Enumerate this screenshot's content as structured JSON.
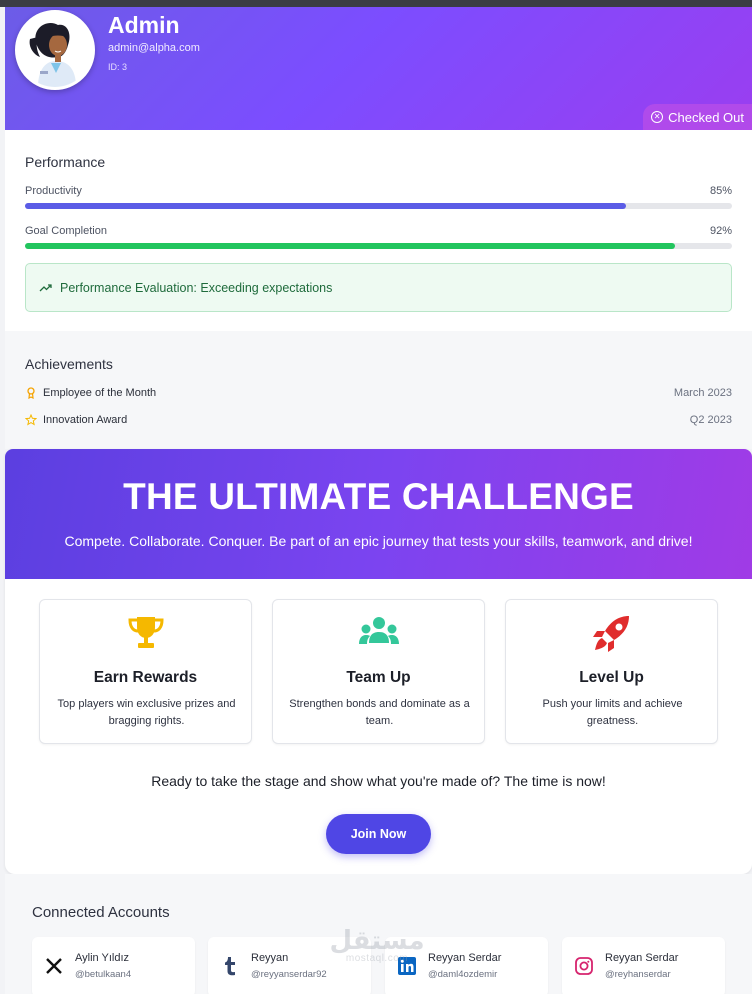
{
  "profile": {
    "name": "Admin",
    "email": "admin@alpha.com",
    "id_text": "ID: 3",
    "status": "Checked Out"
  },
  "performance": {
    "title": "Performance",
    "metrics": [
      {
        "label": "Productivity",
        "value_text": "85%",
        "value": 0.85,
        "color": "#5b5ce6"
      },
      {
        "label": "Goal Completion",
        "value_text": "92%",
        "value": 0.92,
        "color": "#22c55e"
      }
    ],
    "evaluation": "Performance Evaluation: Exceeding expectations"
  },
  "achievements": {
    "title": "Achievements",
    "items": [
      {
        "label": "Employee of the Month",
        "date": "March 2023",
        "icon": "medal-icon"
      },
      {
        "label": "Innovation Award",
        "date": "Q2 2023",
        "icon": "star-icon"
      }
    ]
  },
  "challenge": {
    "title": "THE ULTIMATE CHALLENGE",
    "subtitle": "Compete. Collaborate. Conquer. Be part of an epic journey that tests your skills, teamwork, and drive!",
    "features": [
      {
        "title": "Earn Rewards",
        "desc": "Top players win exclusive prizes and bragging rights.",
        "icon": "trophy-icon",
        "color": "#f5b800"
      },
      {
        "title": "Team Up",
        "desc": "Strengthen bonds and dominate as a team.",
        "icon": "users-icon",
        "color": "#34c79a"
      },
      {
        "title": "Level Up",
        "desc": "Push your limits and achieve greatness.",
        "icon": "rocket-icon",
        "color": "#e02d2d"
      }
    ],
    "cta": "Ready to take the stage and show what you're made of? The time is now!",
    "button": "Join Now"
  },
  "accounts": {
    "title": "Connected Accounts",
    "items": [
      {
        "name": "Aylin Yıldız",
        "handle": "@betulkaan4",
        "icon": "x-icon"
      },
      {
        "name": "Reyyan",
        "handle": "@reyyanserdar92",
        "icon": "tumblr-icon"
      },
      {
        "name": "Reyyan Serdar",
        "handle": "@daml4ozdemir",
        "icon": "linkedin-icon"
      },
      {
        "name": "Reyyan Serdar",
        "handle": "@reyhanserdar",
        "icon": "instagram-icon"
      }
    ]
  },
  "watermark": {
    "arabic": "مستقل",
    "latin": "mostaql.com"
  }
}
